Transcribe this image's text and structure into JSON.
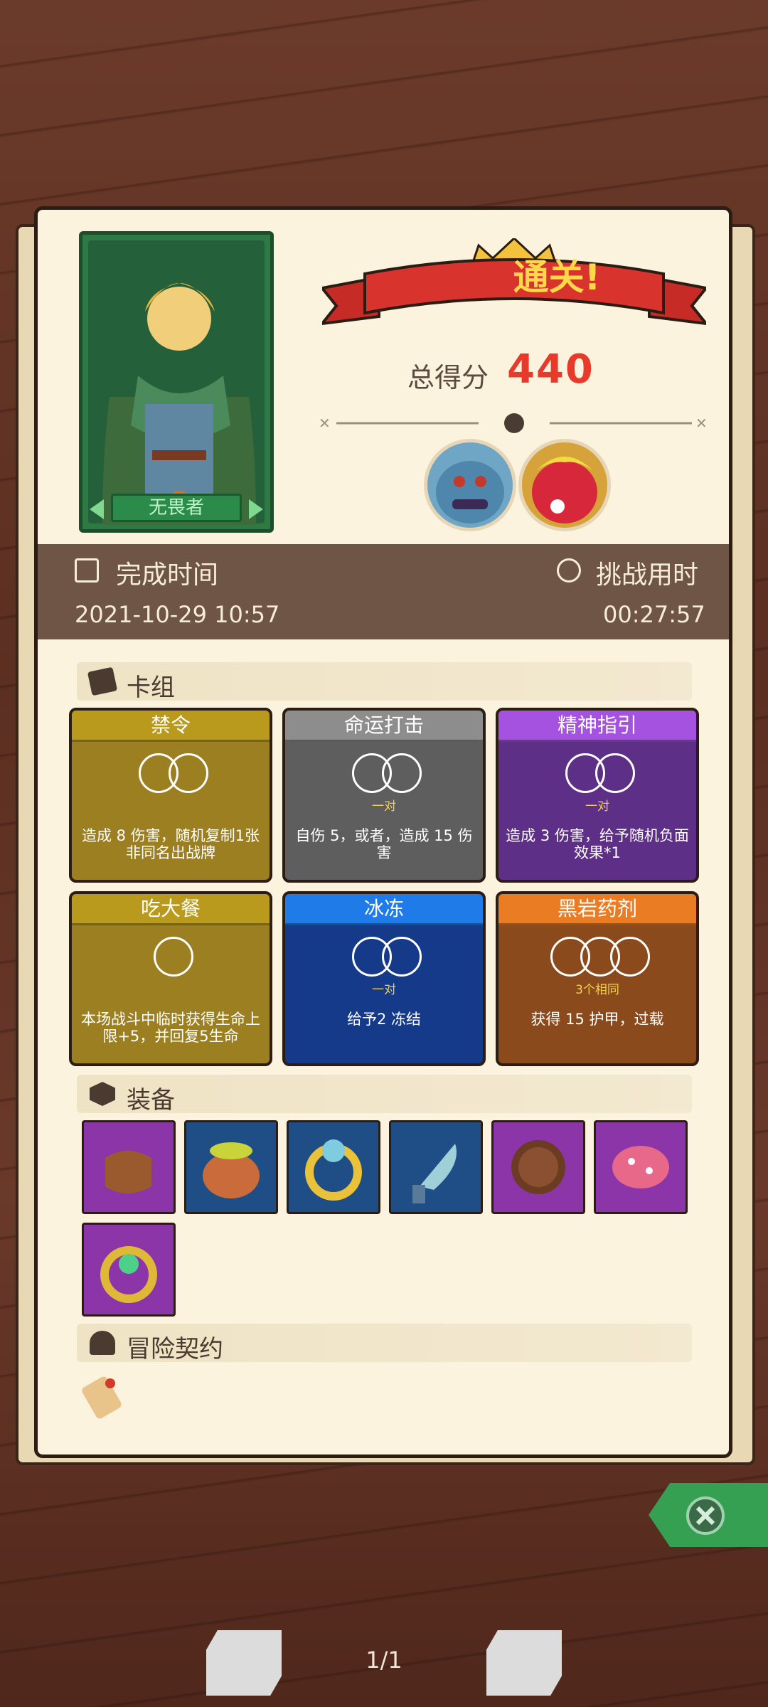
{
  "result": {
    "title": "通关!",
    "score_label": "总得分",
    "score": "440"
  },
  "hero": {
    "name": "无畏者"
  },
  "time": {
    "finish_label": "完成时间",
    "finish_value": "2021-10-29 10:57",
    "duration_label": "挑战用时",
    "duration_value": "00:27:57"
  },
  "sections": {
    "deck": "卡组",
    "equipment": "装备",
    "contract": "冒险契约"
  },
  "cards": [
    {
      "name": "禁令",
      "color": "#b99a1c",
      "body": "#9c7f21",
      "desc": "造成 8 伤害，随机复制1张非同名出战牌",
      "sub": ""
    },
    {
      "name": "命运打击",
      "color": "#8d8d8d",
      "body": "#5e5e5e",
      "desc": "自伤 5，或者，造成 15 伤害",
      "sub": "一对"
    },
    {
      "name": "精神指引",
      "color": "#a552e0",
      "body": "#5e2f86",
      "desc": "造成 3 伤害，给予随机负面效果*1",
      "sub": "一对"
    },
    {
      "name": "吃大餐",
      "color": "#b99a1c",
      "body": "#9c7f21",
      "desc": "本场战斗中临时获得生命上限+5，并回复5生命",
      "sub": ""
    },
    {
      "name": "冰冻",
      "color": "#1e7be8",
      "body": "#163a8a",
      "desc": "给予2 冻结",
      "sub": "一对"
    },
    {
      "name": "黑岩药剂",
      "color": "#ea7d23",
      "body": "#8a4a1c",
      "desc": "获得 15 护甲，过载",
      "sub": "3个相同"
    }
  ],
  "pager": {
    "text": "1/1"
  },
  "colors": {
    "accent": "#e73a2a",
    "paper": "#fbf3de",
    "band": "#6f5546"
  }
}
